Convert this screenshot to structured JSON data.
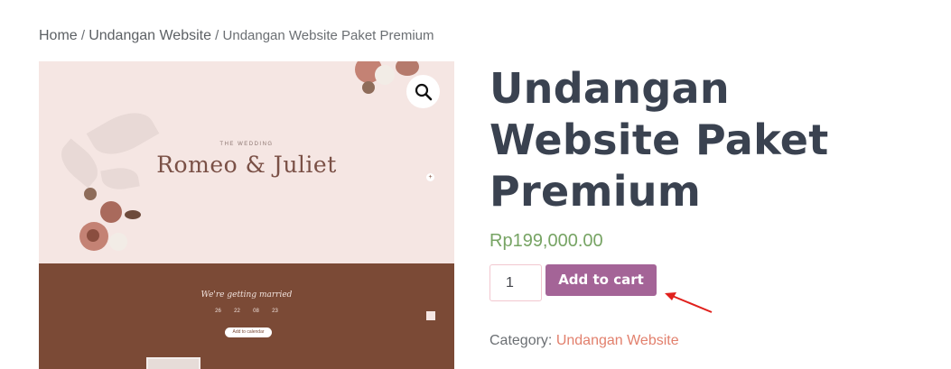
{
  "breadcrumb": {
    "home": "Home",
    "category": "Undangan Website",
    "current": "Undangan Website Paket Premium",
    "separator": "/"
  },
  "gallery": {
    "subtitle": "THE WEDDING",
    "couple": "Romeo & Juliet",
    "getting_married": "We're getting married",
    "countdown": [
      "26",
      "22",
      "08",
      "23"
    ],
    "save_date": "Add to calendar",
    "zoom_icon": "magnifier-icon"
  },
  "product": {
    "title": "Undangan Website Paket Premium",
    "price": "Rp199,000.00",
    "quantity": "1",
    "add_to_cart": "Add to cart",
    "category_label": "Category:",
    "category_value": "Undangan Website"
  },
  "colors": {
    "title": "#3a4250",
    "price": "#77a464",
    "button": "#a46497",
    "category_link": "#e2806d",
    "arrow": "#e0201c"
  }
}
